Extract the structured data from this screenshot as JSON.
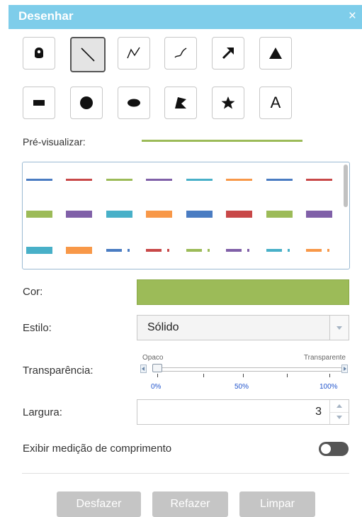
{
  "header": {
    "title": "Desenhar",
    "close_label": "×"
  },
  "tools": [
    {
      "name": "point",
      "selected": false
    },
    {
      "name": "line",
      "selected": true
    },
    {
      "name": "polyline",
      "selected": false
    },
    {
      "name": "freehand-polyline",
      "selected": false
    },
    {
      "name": "arrow",
      "selected": false
    },
    {
      "name": "triangle",
      "selected": false
    },
    {
      "name": "rectangle",
      "selected": false
    },
    {
      "name": "circle",
      "selected": false
    },
    {
      "name": "ellipse",
      "selected": false
    },
    {
      "name": "polygon",
      "selected": false
    },
    {
      "name": "freehand-polygon",
      "selected": false
    },
    {
      "name": "text",
      "selected": false,
      "glyph": "A"
    }
  ],
  "preview": {
    "label": "Pré-visualizar:",
    "color": "#9cbb58"
  },
  "swatches": {
    "row1": [
      "#4a7cc2",
      "#c84848",
      "#9cbb58",
      "#8060a8",
      "#48b0c8",
      "#f89848",
      "#4a7cc2",
      "#c84848"
    ],
    "row2": [
      "#9cbb58",
      "#8060a8",
      "#48b0c8",
      "#f89848",
      "#4a7cc2",
      "#c84848",
      "#9cbb58",
      "#8060a8"
    ],
    "row3": [
      "#48b0c8",
      "#f89848",
      "#4a7cc2",
      "#c84848",
      "#9cbb58",
      "#8060a8",
      "#48b0c8",
      "#f89848"
    ]
  },
  "color": {
    "label": "Cor:",
    "value": "#9cbb58"
  },
  "style": {
    "label": "Estilo:",
    "value": "Sólido"
  },
  "transparency": {
    "label": "Transparência:",
    "min_label": "Opaco",
    "max_label": "Transparente",
    "value": 0,
    "ticks": [
      "0%",
      "50%",
      "100%"
    ]
  },
  "width": {
    "label": "Largura:",
    "value": "3"
  },
  "measure": {
    "label": "Exibir medição de comprimento",
    "enabled": false
  },
  "buttons": {
    "undo": "Desfazer",
    "redo": "Refazer",
    "clear": "Limpar"
  }
}
